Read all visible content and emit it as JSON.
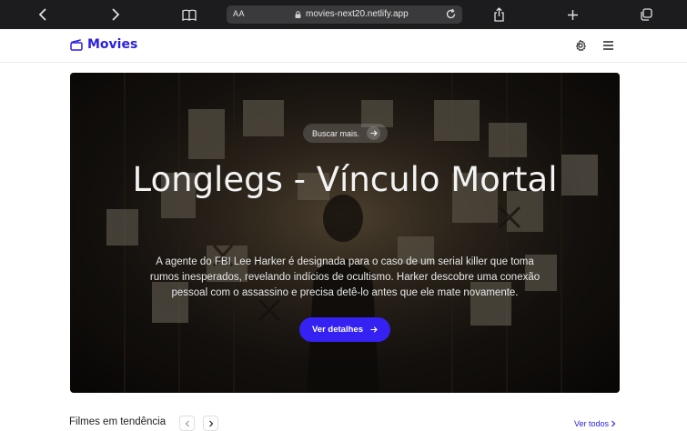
{
  "browser": {
    "text_size_label": "AA",
    "url": "movies-next20.netlify.app"
  },
  "nav": {
    "brand": "Movies"
  },
  "hero": {
    "search_label": "Buscar mais.",
    "title": "Longlegs - Vínculo Mortal",
    "description": "A agente do FBI Lee Harker é designada para o caso de um serial killer que toma rumos inesperados, revelando indícios de ocultismo. Harker descobre uma conexão pessoal com o assassino e precisa detê-lo antes que ele mate novamente.",
    "details_label": "Ver detalhes"
  },
  "trending": {
    "title": "Filmes em tendência",
    "see_all": "Ver todos"
  },
  "colors": {
    "brand": "#2a21e0",
    "primary_button": "#3522f2",
    "chrome": "#1c1c1e"
  }
}
